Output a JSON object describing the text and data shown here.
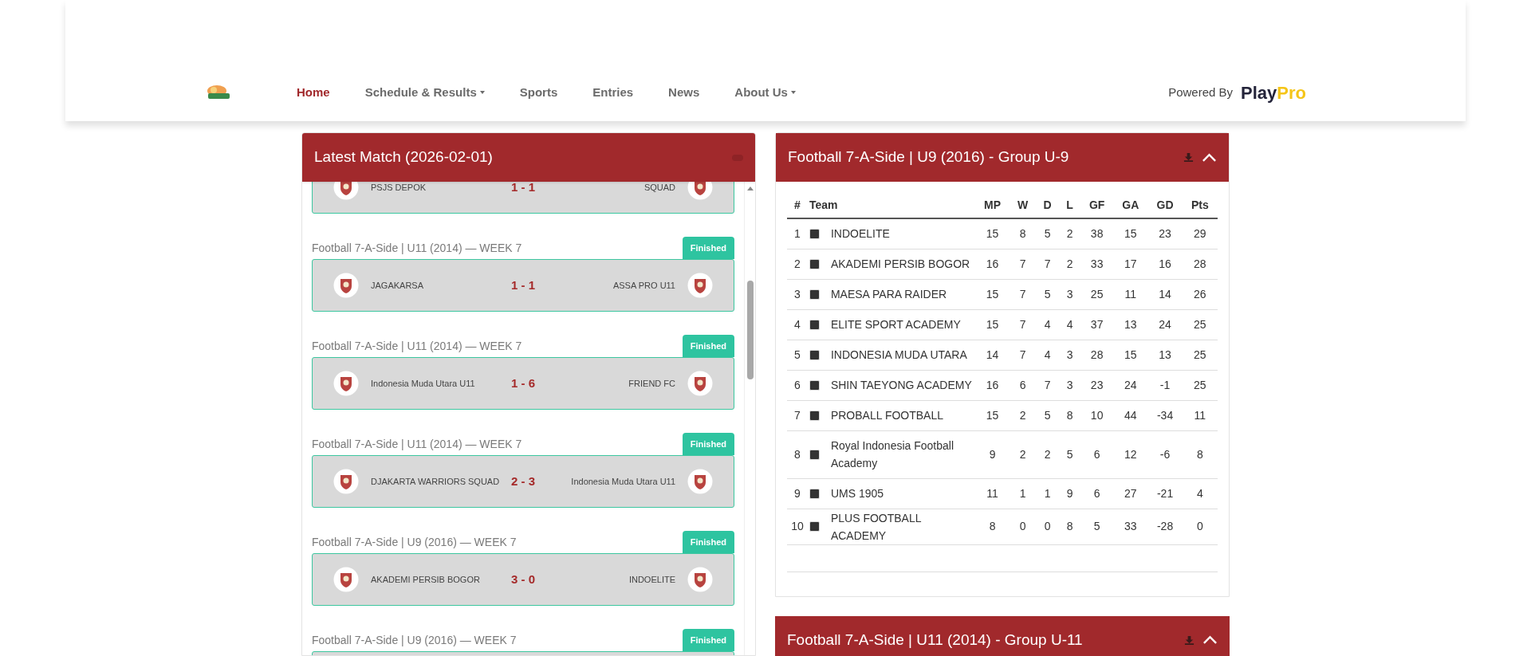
{
  "nav": {
    "items": [
      {
        "label": "Home",
        "selected": true,
        "dropdown": false
      },
      {
        "label": "Schedule & Results",
        "selected": false,
        "dropdown": true
      },
      {
        "label": "Sports",
        "selected": false,
        "dropdown": false
      },
      {
        "label": "Entries",
        "selected": false,
        "dropdown": false
      },
      {
        "label": "News",
        "selected": false,
        "dropdown": false
      },
      {
        "label": "About Us",
        "selected": false,
        "dropdown": true
      }
    ]
  },
  "powered_by": {
    "label": "Powered By",
    "brand_1": "Play",
    "brand_2": "Pro"
  },
  "latest_match": {
    "title": "Latest Match (2026-02-01)",
    "matches": [
      {
        "home": "PSJS DEPOK",
        "score": "1 - 1",
        "away": "SQUAD"
      },
      {
        "group": "Football 7-A-Side | U11 (2014) — WEEK 7",
        "status": "Finished",
        "home": "JAGAKARSA",
        "score": "1 - 1",
        "away": "ASSA PRO U11"
      },
      {
        "group": "Football 7-A-Side | U11 (2014) — WEEK 7",
        "status": "Finished",
        "home": "Indonesia Muda Utara U11",
        "score": "1 - 6",
        "away": "FRIEND FC"
      },
      {
        "group": "Football 7-A-Side | U11 (2014) — WEEK 7",
        "status": "Finished",
        "home": "DJAKARTA WARRIORS SQUAD",
        "score": "2 - 3",
        "away": "Indonesia Muda Utara U11"
      },
      {
        "group": "Football 7-A-Side | U9 (2016) — WEEK 7",
        "status": "Finished",
        "home": "AKADEMI PERSIB BOGOR",
        "score": "3 - 0",
        "away": "INDOELITE"
      },
      {
        "group": "Football 7-A-Side | U9 (2016) — WEEK 7",
        "status": "Finished"
      }
    ]
  },
  "standings": [
    {
      "title": "Football 7-A-Side | U9 (2016) - Group U-9",
      "expanded": true,
      "columns": [
        "#",
        "Team",
        "MP",
        "W",
        "D",
        "L",
        "GF",
        "GA",
        "GD",
        "Pts"
      ],
      "rows": [
        [
          "1",
          "INDOELITE",
          "15",
          "8",
          "5",
          "2",
          "38",
          "15",
          "23",
          "29"
        ],
        [
          "2",
          "AKADEMI PERSIB BOGOR",
          "16",
          "7",
          "7",
          "2",
          "33",
          "17",
          "16",
          "28"
        ],
        [
          "3",
          "MAESA PARA RAIDER",
          "15",
          "7",
          "5",
          "3",
          "25",
          "11",
          "14",
          "26"
        ],
        [
          "4",
          "ELITE SPORT ACADEMY",
          "15",
          "7",
          "4",
          "4",
          "37",
          "13",
          "24",
          "25"
        ],
        [
          "5",
          "INDONESIA MUDA UTARA",
          "14",
          "7",
          "4",
          "3",
          "28",
          "15",
          "13",
          "25"
        ],
        [
          "6",
          "SHIN TAEYONG ACADEMY",
          "16",
          "6",
          "7",
          "3",
          "23",
          "24",
          "-1",
          "25"
        ],
        [
          "7",
          "PROBALL FOOTBALL",
          "15",
          "2",
          "5",
          "8",
          "10",
          "44",
          "-34",
          "11"
        ],
        [
          "8",
          "Royal Indonesia Football Academy",
          "9",
          "2",
          "2",
          "5",
          "6",
          "12",
          "-6",
          "8"
        ],
        [
          "9",
          "UMS 1905",
          "11",
          "1",
          "1",
          "9",
          "6",
          "27",
          "-21",
          "4"
        ],
        [
          "10",
          "PLUS FOOTBALL ACADEMY",
          "8",
          "0",
          "0",
          "8",
          "5",
          "33",
          "-28",
          "0"
        ]
      ]
    },
    {
      "title": "Football 7-A-Side | U11 (2014) - Group U-11",
      "expanded": true
    }
  ]
}
